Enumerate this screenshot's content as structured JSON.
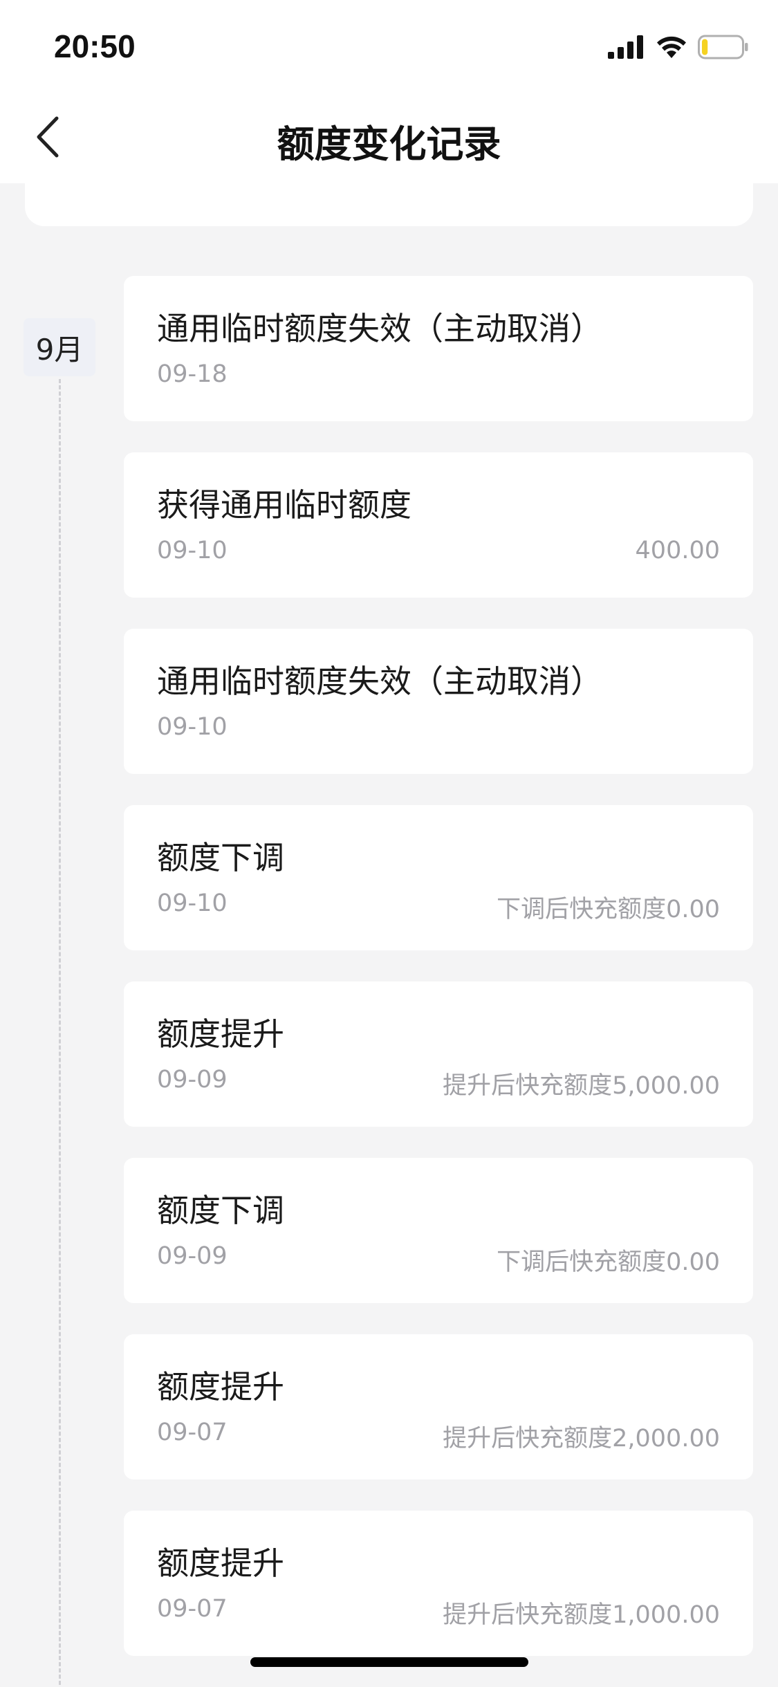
{
  "status_bar": {
    "time": "20:50",
    "icons": [
      "signal-icon",
      "wifi-icon",
      "battery-icon"
    ],
    "battery_level": 0.15,
    "battery_color": "#f5d222"
  },
  "nav": {
    "title": "额度变化记录",
    "back_icon": "chevron-left-icon"
  },
  "timeline": {
    "month_label": "9月"
  },
  "records": [
    {
      "title": "通用临时额度失效（主动取消）",
      "date": "09-18",
      "amount": ""
    },
    {
      "title": "获得通用临时额度",
      "date": "09-10",
      "amount": "400.00"
    },
    {
      "title": "通用临时额度失效（主动取消）",
      "date": "09-10",
      "amount": ""
    },
    {
      "title": "额度下调",
      "date": "09-10",
      "amount": "下调后快充额度0.00"
    },
    {
      "title": "额度提升",
      "date": "09-09",
      "amount": "提升后快充额度5,000.00"
    },
    {
      "title": "额度下调",
      "date": "09-09",
      "amount": "下调后快充额度0.00"
    },
    {
      "title": "额度提升",
      "date": "09-07",
      "amount": "提升后快充额度2,000.00"
    },
    {
      "title": "额度提升",
      "date": "09-07",
      "amount": "提升后快充额度1,000.00"
    }
  ]
}
